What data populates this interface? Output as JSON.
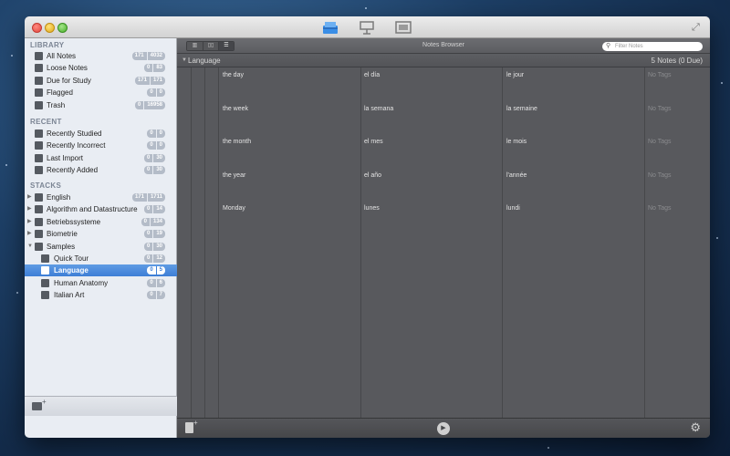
{
  "window": {
    "fullscreen_icon": "fullscreen-icon"
  },
  "toolbar_icons": [
    "browse-icon",
    "study-icon",
    "present-icon"
  ],
  "sidebar": {
    "sections": [
      {
        "header": "LIBRARY",
        "items": [
          {
            "label": "All Notes",
            "icon": "notes-icon",
            "a": "171",
            "b": "4032"
          },
          {
            "label": "Loose Notes",
            "icon": "loose-notes-icon",
            "a": "0",
            "b": "83"
          },
          {
            "label": "Due for Study",
            "icon": "calendar-icon",
            "a": "171",
            "b": "171"
          },
          {
            "label": "Flagged",
            "icon": "flag-icon",
            "a": "0",
            "b": "0"
          },
          {
            "label": "Trash",
            "icon": "trash-icon",
            "a": "0",
            "b": "16958"
          }
        ]
      },
      {
        "header": "RECENT",
        "items": [
          {
            "label": "Recently Studied",
            "icon": "studied-icon",
            "a": "0",
            "b": "0"
          },
          {
            "label": "Recently Incorrect",
            "icon": "warning-icon",
            "a": "0",
            "b": "0"
          },
          {
            "label": "Last Import",
            "icon": "import-icon",
            "a": "0",
            "b": "30"
          },
          {
            "label": "Recently Added",
            "icon": "add-icon",
            "a": "0",
            "b": "30"
          }
        ]
      },
      {
        "header": "STACKS",
        "items": [
          {
            "label": "English",
            "icon": "stack-icon",
            "a": "171",
            "b": "1711"
          },
          {
            "label": "Algorithm and Datastructure",
            "icon": "stack-icon",
            "a": "0",
            "b": "14"
          },
          {
            "label": "Betriebssysteme",
            "icon": "stack-icon",
            "a": "0",
            "b": "134"
          },
          {
            "label": "Biometrie",
            "icon": "stack-icon",
            "a": "0",
            "b": "19"
          },
          {
            "label": "Samples",
            "icon": "stack-icon",
            "a": "0",
            "b": "30",
            "expanded": true
          },
          {
            "label": "Quick Tour",
            "icon": "substack-icon",
            "a": "0",
            "b": "12"
          },
          {
            "label": "Language",
            "icon": "substack-icon",
            "a": "0",
            "b": "5",
            "selected": true
          },
          {
            "label": "Human Anatomy",
            "icon": "substack-icon",
            "a": "0",
            "b": "6"
          },
          {
            "label": "Italian Art",
            "icon": "substack-icon",
            "a": "0",
            "b": "7"
          }
        ]
      }
    ]
  },
  "browser": {
    "title": "Notes Browser",
    "search_placeholder": "Filter Notes",
    "group_name": "Language",
    "group_count": "5 Notes (0 Due)"
  },
  "notes": {
    "rows": [
      {
        "c1": "the day",
        "c2": "el día",
        "c3": "le jour",
        "tags": "No Tags"
      },
      {
        "c1": "the week",
        "c2": "la semana",
        "c3": "la semaine",
        "tags": "No Tags"
      },
      {
        "c1": "the month",
        "c2": "el mes",
        "c3": "le mois",
        "tags": "No Tags"
      },
      {
        "c1": "the year",
        "c2": "el año",
        "c3": "l'année",
        "tags": "No Tags"
      },
      {
        "c1": "Monday",
        "c2": "lunes",
        "c3": "lundi",
        "tags": "No Tags"
      }
    ]
  },
  "colors": {
    "selection": "#3d7ed6",
    "sidebar_bg": "#e9edf3",
    "notes_bg": "#58595d"
  }
}
